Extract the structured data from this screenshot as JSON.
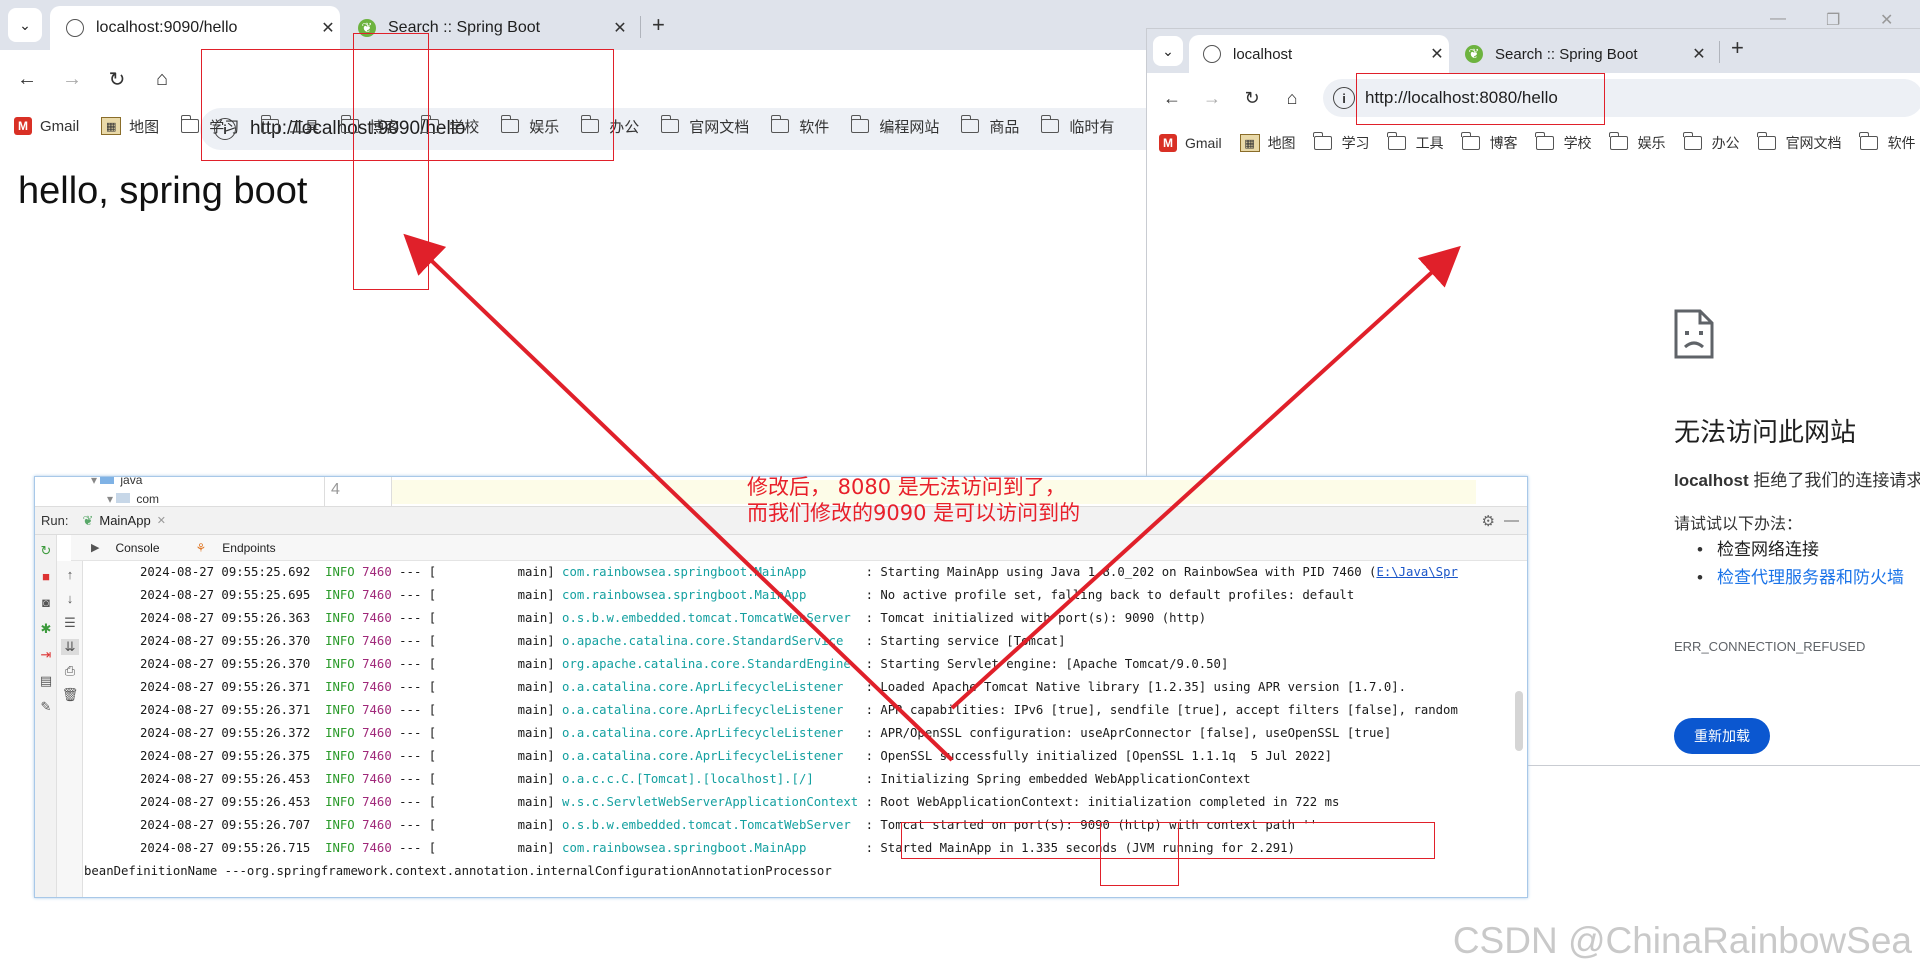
{
  "browser1": {
    "tabs": [
      {
        "label": "localhost:9090/hello",
        "active": true,
        "icon": "globe-icon"
      },
      {
        "label": "Search :: Spring Boot",
        "active": false,
        "icon": "spring-leaf-icon"
      }
    ],
    "url": "http://localhost:9090/hello",
    "bookmarks": [
      "Gmail",
      "地图",
      "学习",
      "工具",
      "博客",
      "学校",
      "娱乐",
      "办公",
      "官网文档",
      "软件",
      "编程网站",
      "商品",
      "临时有"
    ],
    "page_text": "hello, spring boot"
  },
  "browser2": {
    "tabs": [
      {
        "label": "localhost",
        "active": true,
        "icon": "globe-icon"
      },
      {
        "label": "Search :: Spring Boot",
        "active": false,
        "icon": "spring-leaf-icon"
      }
    ],
    "url": "http://localhost:8080/hello",
    "bookmarks": [
      "Gmail",
      "地图",
      "学习",
      "工具",
      "博客",
      "学校",
      "娱乐",
      "办公",
      "官网文档",
      "软件"
    ],
    "error": {
      "title": "无法访问此网站",
      "host": "localhost",
      "message": " 拒绝了我们的连接请求",
      "try_label": "请试试以下办法：",
      "suggestions": [
        "检查网络连接",
        "检查代理服务器和防火墙"
      ],
      "code": "ERR_CONNECTION_REFUSED",
      "reload_label": "重新加载"
    }
  },
  "ide": {
    "tree": {
      "java": "java",
      "com": "com"
    },
    "gutter_line": "4",
    "run_label": "Run:",
    "run_tab": "MainApp",
    "subtabs": [
      "Console",
      "Endpoints"
    ],
    "log": [
      {
        "ts": "2024-08-27 09:55:25.692",
        "level": "INFO",
        "pid": "7460",
        "thread": "main",
        "cls": "com.rainbowsea.springboot.MainApp",
        "msg": "Starting MainApp using Java 1.8.0_202 on RainbowSea with PID 7460 (",
        "link": "E:\\Java\\Spr"
      },
      {
        "ts": "2024-08-27 09:55:25.695",
        "level": "INFO",
        "pid": "7460",
        "thread": "main",
        "cls": "com.rainbowsea.springboot.MainApp",
        "msg": "No active profile set, falling back to default profiles: default"
      },
      {
        "ts": "2024-08-27 09:55:26.363",
        "level": "INFO",
        "pid": "7460",
        "thread": "main",
        "cls": "o.s.b.w.embedded.tomcat.TomcatWebServer",
        "msg": "Tomcat initialized with port(s): 9090 (http)"
      },
      {
        "ts": "2024-08-27 09:55:26.370",
        "level": "INFO",
        "pid": "7460",
        "thread": "main",
        "cls": "o.apache.catalina.core.StandardService",
        "msg": "Starting service [Tomcat]"
      },
      {
        "ts": "2024-08-27 09:55:26.370",
        "level": "INFO",
        "pid": "7460",
        "thread": "main",
        "cls": "org.apache.catalina.core.StandardEngine",
        "msg": "Starting Servlet engine: [Apache Tomcat/9.0.50]"
      },
      {
        "ts": "2024-08-27 09:55:26.371",
        "level": "INFO",
        "pid": "7460",
        "thread": "main",
        "cls": "o.a.catalina.core.AprLifecycleListener",
        "msg": "Loaded Apache Tomcat Native library [1.2.35] using APR version [1.7.0]."
      },
      {
        "ts": "2024-08-27 09:55:26.371",
        "level": "INFO",
        "pid": "7460",
        "thread": "main",
        "cls": "o.a.catalina.core.AprLifecycleListener",
        "msg": "APR capabilities: IPv6 [true], sendfile [true], accept filters [false], random"
      },
      {
        "ts": "2024-08-27 09:55:26.372",
        "level": "INFO",
        "pid": "7460",
        "thread": "main",
        "cls": "o.a.catalina.core.AprLifecycleListener",
        "msg": "APR/OpenSSL configuration: useAprConnector [false], useOpenSSL [true]"
      },
      {
        "ts": "2024-08-27 09:55:26.375",
        "level": "INFO",
        "pid": "7460",
        "thread": "main",
        "cls": "o.a.catalina.core.AprLifecycleListener",
        "msg": "OpenSSL successfully initialized [OpenSSL 1.1.1q  5 Jul 2022]"
      },
      {
        "ts": "2024-08-27 09:55:26.453",
        "level": "INFO",
        "pid": "7460",
        "thread": "main",
        "cls": "o.a.c.c.C.[Tomcat].[localhost].[/]",
        "msg": "Initializing Spring embedded WebApplicationContext"
      },
      {
        "ts": "2024-08-27 09:55:26.453",
        "level": "INFO",
        "pid": "7460",
        "thread": "main",
        "cls": "w.s.c.ServletWebServerApplicationContext",
        "msg": "Root WebApplicationContext: initialization completed in 722 ms"
      },
      {
        "ts": "2024-08-27 09:55:26.707",
        "level": "INFO",
        "pid": "7460",
        "thread": "main",
        "cls": "o.s.b.w.embedded.tomcat.TomcatWebServer",
        "msg": "Tomcat started on port(s): 9090 (http) with context path ''"
      },
      {
        "ts": "2024-08-27 09:55:26.715",
        "level": "INFO",
        "pid": "7460",
        "thread": "main",
        "cls": "com.rainbowsea.springboot.MainApp",
        "msg": "Started MainApp in 1.335 seconds (JVM running for 2.291)"
      }
    ],
    "trailing_line": "beanDefinitionName ---org.springframework.context.annotation.internalConfigurationAnnotationProcessor"
  },
  "annotation": {
    "text": "修改后， 8080 是无法访问到了，\n而我们修改的9090 是可以访问到的",
    "color": "#e8202a"
  },
  "watermark": "CSDN @ChinaRainbowSea"
}
